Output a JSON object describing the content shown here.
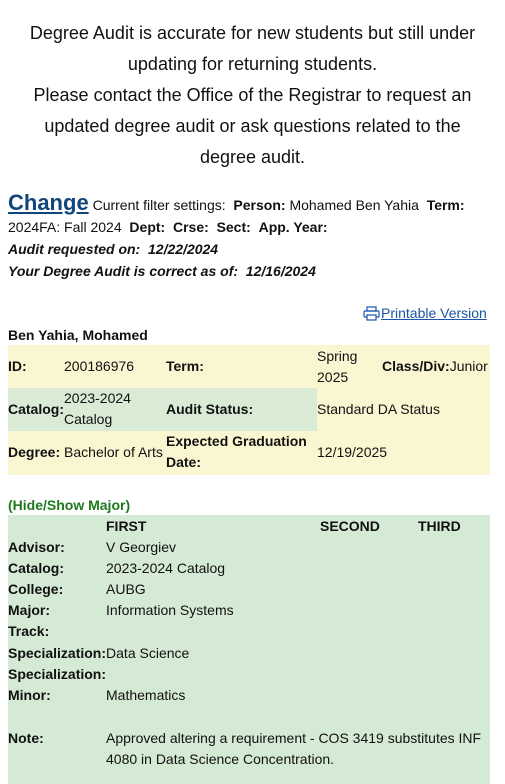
{
  "notice": {
    "line1": "Degree Audit is accurate for new students but still under",
    "line2": "updating for returning students.",
    "line3": "Please contact the Office of the Registrar to request an",
    "line4": "updated degree audit or ask questions related to the",
    "line5": "degree audit."
  },
  "filter": {
    "change_label": "Change",
    "settings_label": "Current filter settings:",
    "person_label": "Person:",
    "person_value": "Mohamed Ben Yahia",
    "term_label": "Term:",
    "term_value": "2024FA: Fall 2024",
    "dept_label": "Dept:",
    "crse_label": "Crse:",
    "sect_label": "Sect:",
    "appyear_label": "App. Year:",
    "requested_label": "Audit requested on:",
    "requested_value": "12/22/2024",
    "correct_label": "Your Degree Audit is correct as of:",
    "correct_value": "12/16/2024"
  },
  "printable_label": "Printable Version",
  "student_name": "Ben Yahia, Mohamed",
  "summary": {
    "id_label": "ID:",
    "id_value": "200186976",
    "term_label": "Term:",
    "term_value_1": "Spring",
    "term_value_2": "2025",
    "class_label": "Class/Div:",
    "class_value": "Junior",
    "catalog_label": "Catalog:",
    "catalog_value_1": "2023-2024",
    "catalog_value_2": "Catalog",
    "audit_status_label": "Audit Status:",
    "audit_status_value": "Standard DA Status",
    "degree_label": "Degree:",
    "degree_value": "Bachelor of Arts",
    "grad_label_1": "Expected Graduation",
    "grad_label_2": "Date:",
    "grad_value": "12/19/2025"
  },
  "hide_show_label": "(Hide/Show Major)",
  "major": {
    "col_first": "FIRST",
    "col_second": "SECOND",
    "col_third": "THIRD",
    "advisor_label": "Advisor:",
    "advisor_value": "V Georgiev",
    "catalog_label": "Catalog:",
    "catalog_value": "2023-2024 Catalog",
    "college_label": "College:",
    "college_value": "AUBG",
    "major_label": "Major:",
    "major_value": "Information Systems",
    "track_label": "Track:",
    "spec1_label": "Specialization:",
    "spec1_value": "Data Science",
    "spec2_label": "Specialization:",
    "minor_label": "Minor:",
    "minor_value": "Mathematics",
    "note_label": "Note:",
    "note_line1": "Approved altering a requirement - COS 3419 substitutes INF",
    "note_line2": "4080 in Data Science Concentration."
  },
  "colors": {
    "yellow_bg": "#faf6d2",
    "green_bg": "#d9ebd5",
    "major_bg": "#d4ead4",
    "link_blue": "#1a55a8",
    "change_blue": "#10467a",
    "hide_green": "#1c7a1c"
  }
}
